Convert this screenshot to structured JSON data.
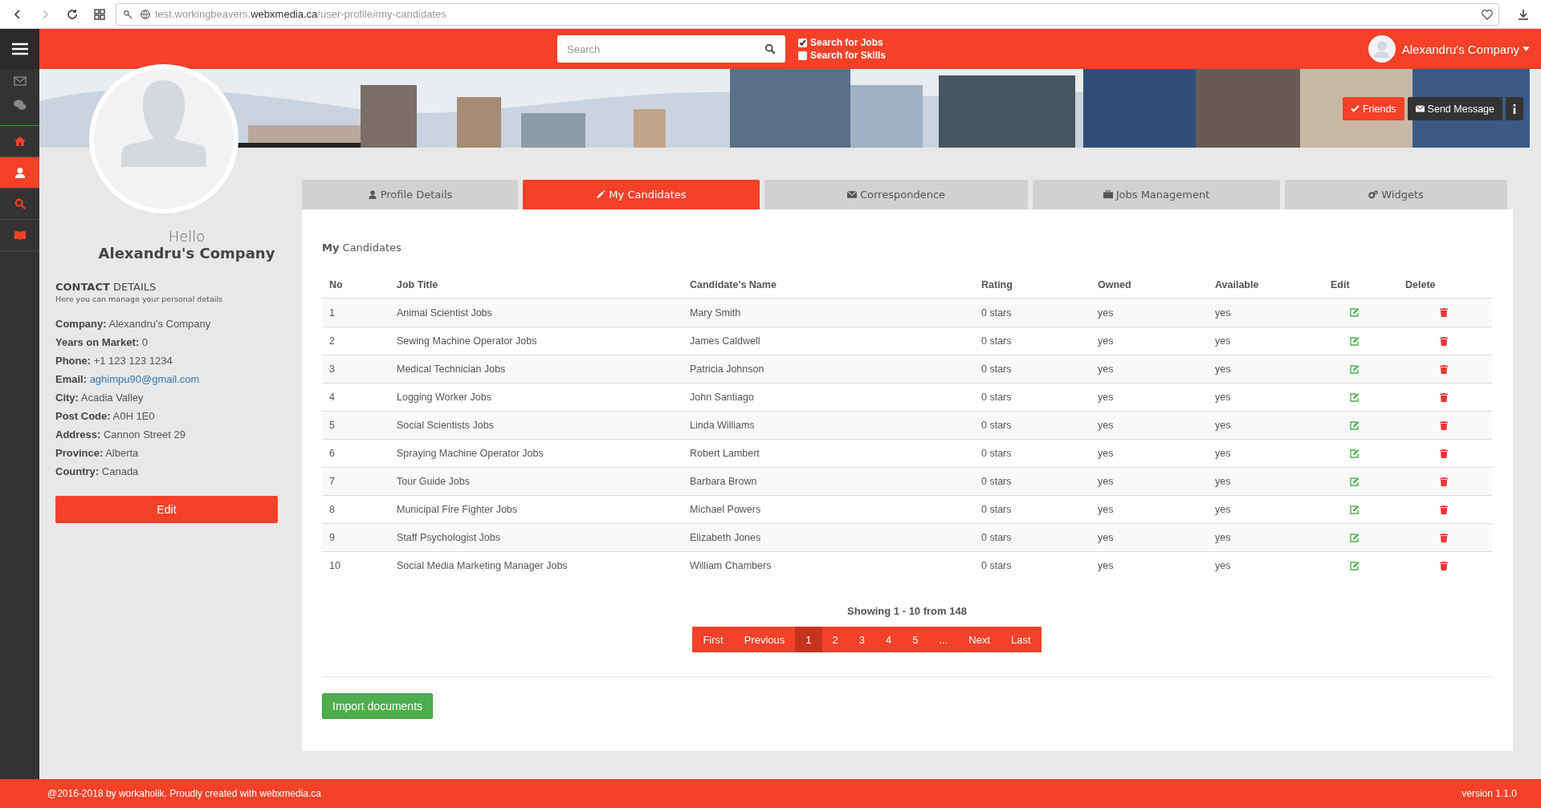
{
  "browser": {
    "url": {
      "prefix": "test.workingbeavers.",
      "domain": "webxmedia.ca",
      "path": "/user-profile#my-candidates"
    }
  },
  "topbar": {
    "search": {
      "placeholder": "Search"
    },
    "options": [
      {
        "label": "Search for Jobs",
        "checked": true
      },
      {
        "label": "Search for Skills",
        "checked": false
      }
    ],
    "user": "Alexandru's Company"
  },
  "sidebar": {
    "items": [
      {
        "selected": false
      },
      {
        "selected": false
      },
      {
        "selected": false
      },
      {
        "selected": true
      },
      {
        "selected": false
      },
      {
        "selected": false
      }
    ]
  },
  "banner": {
    "buttons": [
      {
        "label": "Friends",
        "kind": "primary"
      },
      {
        "label": "Send Message",
        "kind": "dark"
      }
    ]
  },
  "profile": {
    "greeting": "Hello",
    "name": "Alexandru's Company",
    "section_title": "**CONTACT** DETAILS",
    "section_hint": "Here you can manage your personal details",
    "details": [
      {
        "label": "Company:",
        "value": "Alexandru's Company",
        "kind": "text"
      },
      {
        "label": "Years on Market:",
        "value": "0",
        "kind": "text"
      },
      {
        "label": "Phone:",
        "value": "+1 123 123 1234",
        "kind": "text"
      },
      {
        "label": "Email:",
        "value": "aghimpu90@gmail.com",
        "kind": "link"
      },
      {
        "label": "City:",
        "value": "Acadia Valley",
        "kind": "text"
      },
      {
        "label": "Post Code:",
        "value": "A0H 1E0",
        "kind": "text"
      },
      {
        "label": "Address:",
        "value": "Cannon Street 29",
        "kind": "text"
      },
      {
        "label": "Province:",
        "value": "Alberta",
        "kind": "text"
      },
      {
        "label": "Country:",
        "value": "Canada",
        "kind": "text"
      }
    ],
    "edit_button": "Edit"
  },
  "tabs": [
    {
      "label": "Profile Details",
      "selected": false
    },
    {
      "label": "My Candidates",
      "selected": true
    },
    {
      "label": "Correspondence",
      "selected": false
    },
    {
      "label": "Jobs Management",
      "selected": false
    },
    {
      "label": "Widgets",
      "selected": false
    }
  ],
  "panel": {
    "title": "**My** Candidates",
    "table": {
      "columns": [
        "No",
        "Job Title",
        "Candidate's Name",
        "Rating",
        "Owned",
        "Available",
        "Edit",
        "Delete"
      ],
      "rows": [
        {
          "no": "1",
          "job_title": "Animal Scientist Jobs",
          "name": "Mary Smith",
          "rating": "0 stars",
          "owned": "yes",
          "available": "yes"
        },
        {
          "no": "2",
          "job_title": "Sewing Machine Operator Jobs",
          "name": "James Caldwell",
          "rating": "0 stars",
          "owned": "yes",
          "available": "yes"
        },
        {
          "no": "3",
          "job_title": "Medical Technician Jobs",
          "name": "Patricia Johnson",
          "rating": "0 stars",
          "owned": "yes",
          "available": "yes"
        },
        {
          "no": "4",
          "job_title": "Logging Worker Jobs",
          "name": "John Santiago",
          "rating": "0 stars",
          "owned": "yes",
          "available": "yes"
        },
        {
          "no": "5",
          "job_title": "Social Scientists Jobs",
          "name": "Linda Williams",
          "rating": "0 stars",
          "owned": "yes",
          "available": "yes"
        },
        {
          "no": "6",
          "job_title": "Spraying Machine Operator Jobs",
          "name": "Robert Lambert",
          "rating": "0 stars",
          "owned": "yes",
          "available": "yes"
        },
        {
          "no": "7",
          "job_title": "Tour Guide Jobs",
          "name": "Barbara Brown",
          "rating": "0 stars",
          "owned": "yes",
          "available": "yes"
        },
        {
          "no": "8",
          "job_title": "Municipal Fire Fighter Jobs",
          "name": "Michael Powers",
          "rating": "0 stars",
          "owned": "yes",
          "available": "yes"
        },
        {
          "no": "9",
          "job_title": "Staff Psychologist Jobs",
          "name": "Elizabeth Jones",
          "rating": "0 stars",
          "owned": "yes",
          "available": "yes"
        },
        {
          "no": "10",
          "job_title": "Social Media Marketing Manager Jobs",
          "name": "William Chambers",
          "rating": "0 stars",
          "owned": "yes",
          "available": "yes"
        }
      ]
    },
    "showing": "Showing 1 - 10 from 148",
    "pagination": [
      {
        "label": "First",
        "selected": false
      },
      {
        "label": "Previous",
        "selected": false
      },
      {
        "label": "1",
        "selected": true
      },
      {
        "label": "2",
        "selected": false
      },
      {
        "label": "3",
        "selected": false
      },
      {
        "label": "4",
        "selected": false
      },
      {
        "label": "5",
        "selected": false
      },
      {
        "label": "...",
        "selected": false
      },
      {
        "label": "Next",
        "selected": false
      },
      {
        "label": "Last",
        "selected": false
      }
    ],
    "import_button": "Import documents"
  },
  "footer": {
    "left": "@2016-2018 by workaholik. Proudly created with webxmedia.ca",
    "right": "version 1.1.0"
  }
}
